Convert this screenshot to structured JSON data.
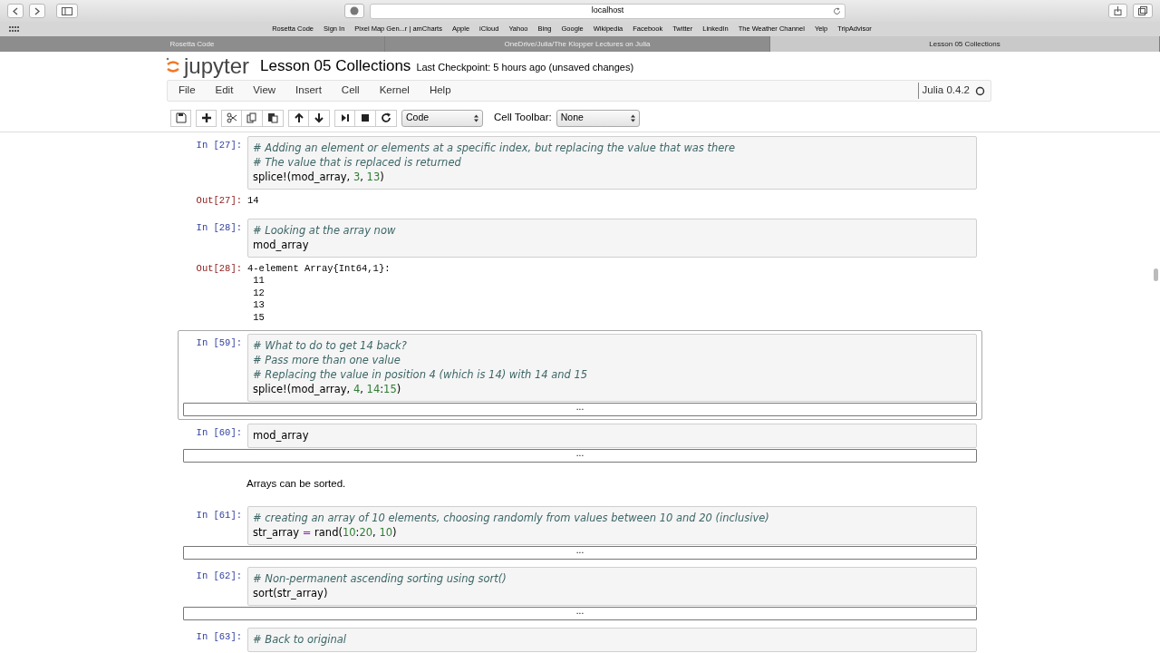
{
  "browser": {
    "address": "localhost",
    "bookmarks": [
      "Rosetta Code",
      "Sign In",
      "Pixel Map Gen...r | amCharts",
      "Apple",
      "iCloud",
      "Yahoo",
      "Bing",
      "Google",
      "Wikipedia",
      "Facebook",
      "Twitter",
      "LinkedIn",
      "The Weather Channel",
      "Yelp",
      "TripAdvisor"
    ],
    "tabs": [
      {
        "label": "Rosetta Code",
        "selected": false
      },
      {
        "label": "OneDrive/Julia/The Klopper Lectures on Julia",
        "selected": false
      },
      {
        "label": "Lesson 05 Collections",
        "selected": true
      }
    ]
  },
  "notebook": {
    "logo": "jupyter",
    "title": "Lesson 05 Collections",
    "checkpoint": "Last Checkpoint: 5 hours ago (unsaved changes)",
    "menu": [
      "File",
      "Edit",
      "View",
      "Insert",
      "Cell",
      "Kernel",
      "Help"
    ],
    "kernel": "Julia 0.4.2",
    "kernel_busy": false,
    "cell_type": "Code",
    "cell_toolbar_label": "Cell Toolbar:",
    "cell_toolbar": "None"
  },
  "cells": [
    {
      "kind": "code",
      "prompt": "In [27]:",
      "selected": false,
      "lines": [
        [
          {
            "text": "# Adding an element or elements at a specific index, but replacing the value that was there",
            "kind": "comment"
          }
        ],
        [
          {
            "text": "# The value that is replaced is returned",
            "kind": "comment"
          }
        ],
        [
          {
            "text": "splice!(mod_array, ",
            "kind": "plain"
          },
          {
            "text": "3",
            "kind": "number"
          },
          {
            "text": ", ",
            "kind": "plain"
          },
          {
            "text": "13",
            "kind": "number"
          },
          {
            "text": ")",
            "kind": "plain"
          }
        ]
      ],
      "output": {
        "kind": "text",
        "prompt": "Out[27]:",
        "lines": [
          "14"
        ]
      }
    },
    {
      "kind": "code",
      "prompt": "In [28]:",
      "selected": false,
      "lines": [
        [
          {
            "text": "# Looking at the array now",
            "kind": "comment"
          }
        ],
        [
          {
            "text": "mod_array",
            "kind": "plain"
          }
        ]
      ],
      "output": {
        "kind": "text",
        "prompt": "Out[28]:",
        "lines": [
          "4-element Array{Int64,1}:",
          " 11",
          " 12",
          " 13",
          " 15"
        ]
      }
    },
    {
      "kind": "code",
      "prompt": "In [59]:",
      "selected": true,
      "lines": [
        [
          {
            "text": "# What to do to get 14 back?",
            "kind": "comment"
          }
        ],
        [
          {
            "text": "# Pass more than one value",
            "kind": "comment"
          }
        ],
        [
          {
            "text": "# Replacing the value in position 4 (which is 14) with 14 and 15",
            "kind": "comment"
          }
        ],
        [
          {
            "text": "splice!(mod_array, ",
            "kind": "plain"
          },
          {
            "text": "4",
            "kind": "number"
          },
          {
            "text": ", ",
            "kind": "plain"
          },
          {
            "text": "14",
            "kind": "number"
          },
          {
            "text": ":",
            "kind": "plain"
          },
          {
            "text": "15",
            "kind": "number"
          },
          {
            "text": ")",
            "kind": "plain"
          }
        ]
      ],
      "output": {
        "kind": "collapsed",
        "text": "..."
      }
    },
    {
      "kind": "code",
      "prompt": "In [60]:",
      "selected": false,
      "lines": [
        [
          {
            "text": "mod_array",
            "kind": "plain"
          }
        ]
      ],
      "output": {
        "kind": "collapsed",
        "text": "..."
      }
    },
    {
      "kind": "markdown",
      "text": "Arrays can be sorted."
    },
    {
      "kind": "code",
      "prompt": "In [61]:",
      "selected": false,
      "lines": [
        [
          {
            "text": "# creating an array of 10 elements, choosing randomly from values between 10 and 20 (inclusive)",
            "kind": "comment"
          }
        ],
        [
          {
            "text": "str_array ",
            "kind": "plain"
          },
          {
            "text": "=",
            "kind": "operator"
          },
          {
            "text": " rand(",
            "kind": "plain"
          },
          {
            "text": "10",
            "kind": "number"
          },
          {
            "text": ":",
            "kind": "plain"
          },
          {
            "text": "20",
            "kind": "number"
          },
          {
            "text": ", ",
            "kind": "plain"
          },
          {
            "text": "10",
            "kind": "number"
          },
          {
            "text": ")",
            "kind": "plain"
          }
        ]
      ],
      "output": {
        "kind": "collapsed",
        "text": "..."
      }
    },
    {
      "kind": "code",
      "prompt": "In [62]:",
      "selected": false,
      "lines": [
        [
          {
            "text": "# Non-permanent ascending sorting using sort()",
            "kind": "comment"
          }
        ],
        [
          {
            "text": "sort(str_array)",
            "kind": "plain"
          }
        ]
      ],
      "output": {
        "kind": "collapsed",
        "text": "..."
      }
    },
    {
      "kind": "code",
      "prompt": "In [63]:",
      "selected": false,
      "lines": [
        [
          {
            "text": "# Back to original",
            "kind": "comment"
          }
        ]
      ]
    }
  ]
}
